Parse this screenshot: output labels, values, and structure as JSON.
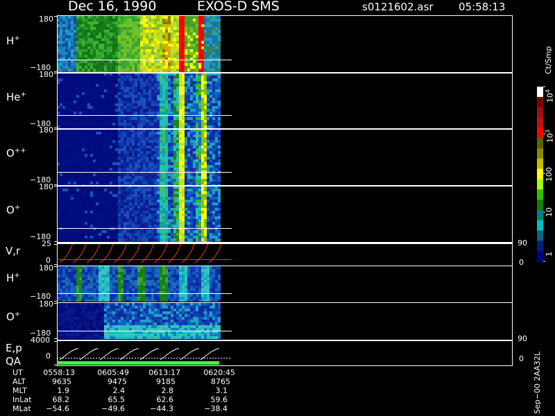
{
  "header": {
    "date": "Dec 16, 1990",
    "instrument": "EXOS-D SMS",
    "file": "s0121602.asr",
    "time": "05:58:13"
  },
  "panels": [
    {
      "label": "H",
      "charge": "+",
      "y_top": "180",
      "y_bottom": "−180"
    },
    {
      "label": "He",
      "charge": "+",
      "y_top": "180",
      "y_bottom": "−180"
    },
    {
      "label": "O",
      "charge": "++",
      "y_top": "180",
      "y_bottom": "−180"
    },
    {
      "label": "O",
      "charge": "+",
      "y_top": "180",
      "y_bottom": "−180"
    },
    {
      "label": "V,r",
      "y_top": "25",
      "y_bottom": "0",
      "right_top": "90",
      "right_bottom": "0"
    },
    {
      "label": "H",
      "charge": "+",
      "y_top": "180",
      "y_bottom": "−180"
    },
    {
      "label": "O",
      "charge": "+",
      "y_top": "180",
      "y_bottom": "−180"
    },
    {
      "label": "E,p",
      "label2": "QA",
      "y_top": "4000",
      "y_bottom": "0",
      "right_top": "90",
      "right_bottom": "0"
    }
  ],
  "colorbar": {
    "unit": "Ct/Smp",
    "ticks": [
      "10",
      "10",
      "100",
      "10",
      "1"
    ],
    "tick_exponents": [
      "4",
      "3",
      "",
      "",
      ""
    ],
    "colors": [
      "#ffffff",
      "#7a0000",
      "#9a1010",
      "#c01010",
      "#ff0000",
      "#606000",
      "#8a8a00",
      "#c0c000",
      "#ffff00",
      "#a0ff00",
      "#30c000",
      "#108000",
      "#008080",
      "#00c0c0",
      "#106080",
      "#002080",
      "#000080"
    ]
  },
  "footer": {
    "rows": [
      {
        "label": "UT",
        "values": [
          "0558:13",
          "0605:49",
          "0613:17",
          "0620:45"
        ]
      },
      {
        "label": "ALT",
        "values": [
          "9635",
          "9475",
          "9185",
          "8765"
        ]
      },
      {
        "label": "MLT",
        "values": [
          "1.9",
          "2.4",
          "2.8",
          "3.1"
        ]
      },
      {
        "label": "InLat",
        "values": [
          "68.2",
          "65.5",
          "62.6",
          "59.6"
        ]
      },
      {
        "label": "MLat",
        "values": [
          "−54.6",
          "−49.6",
          "−44.3",
          "−38.4"
        ]
      }
    ],
    "side_note": "Sep−00 2AA32L"
  },
  "chart_data": {
    "type": "heatmap",
    "title": "Dec 16, 1990   EXOS-D SMS",
    "x_ticks": [
      "0558:13",
      "0605:49",
      "0613:17",
      "0620:45"
    ],
    "ylim": [
      -180,
      180
    ],
    "colorbar_scale": "log",
    "colorbar_range": [
      1,
      10000
    ]
  }
}
